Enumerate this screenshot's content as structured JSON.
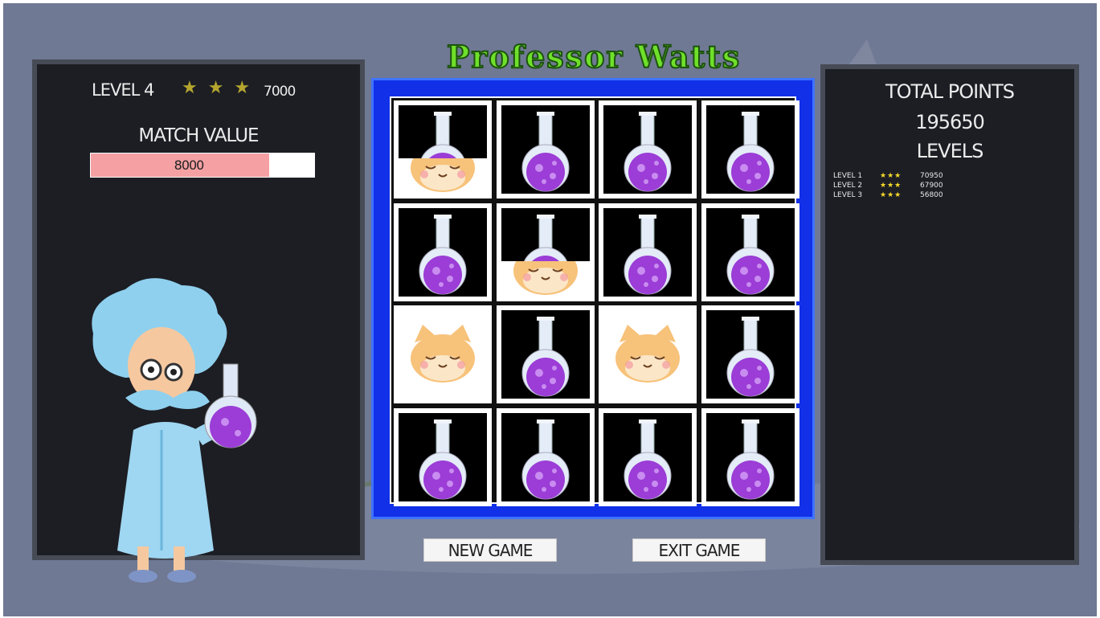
{
  "game": {
    "title": "Professor Watts"
  },
  "left_panel": {
    "level_label": "LEVEL 4",
    "level_stars": "★ ★ ★",
    "level_score": "7000",
    "match_title": "MATCH VALUE",
    "match_value": "8000",
    "match_fraction": 0.8
  },
  "right_panel": {
    "total_title": "TOTAL POINTS",
    "total_value": "195650",
    "levels_title": "LEVELS",
    "levels": [
      {
        "name": "LEVEL 1",
        "stars": "★★★",
        "score": "70950"
      },
      {
        "name": "LEVEL 2",
        "stars": "★★★",
        "score": "67900"
      },
      {
        "name": "LEVEL 3",
        "stars": "★★★",
        "score": "56800"
      }
    ]
  },
  "board": {
    "cells": [
      "half-cat",
      "flask",
      "flask",
      "flask",
      "flask",
      "half-cat-b",
      "flask",
      "flask",
      "cat",
      "flask",
      "cat",
      "flask",
      "flask",
      "flask",
      "flask",
      "flask"
    ]
  },
  "buttons": {
    "new_game": "NEW GAME",
    "exit_game": "EXIT GAME"
  },
  "colors": {
    "board_border": "#1130e8",
    "match_fill": "#f5a0a3",
    "stars": "#b3a52e",
    "flask_liquid": "#9b3dd6"
  }
}
